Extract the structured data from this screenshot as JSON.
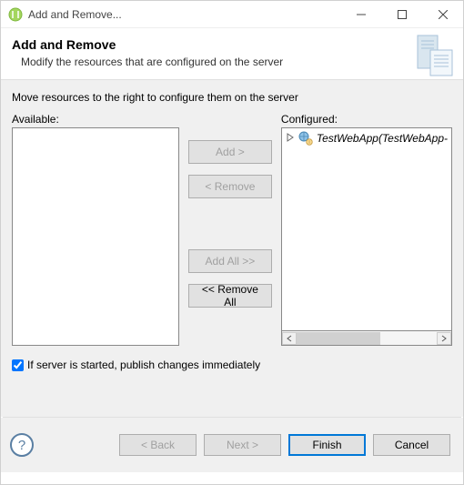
{
  "window": {
    "title": "Add and Remove..."
  },
  "banner": {
    "heading": "Add and Remove",
    "sub": "Modify the resources that are configured on the server"
  },
  "main": {
    "instruction": "Move resources to the right to configure them on the server",
    "available_label": "Available:",
    "configured_label": "Configured:",
    "configured_items": [
      {
        "label": "TestWebApp(TestWebApp-"
      }
    ],
    "buttons": {
      "add": "Add >",
      "remove": "< Remove",
      "add_all": "Add All >>",
      "remove_all": "<< Remove All"
    },
    "publish_checkbox": {
      "checked": true,
      "label": "If server is started, publish changes immediately"
    }
  },
  "footer": {
    "back": "< Back",
    "next": "Next >",
    "finish": "Finish",
    "cancel": "Cancel"
  }
}
